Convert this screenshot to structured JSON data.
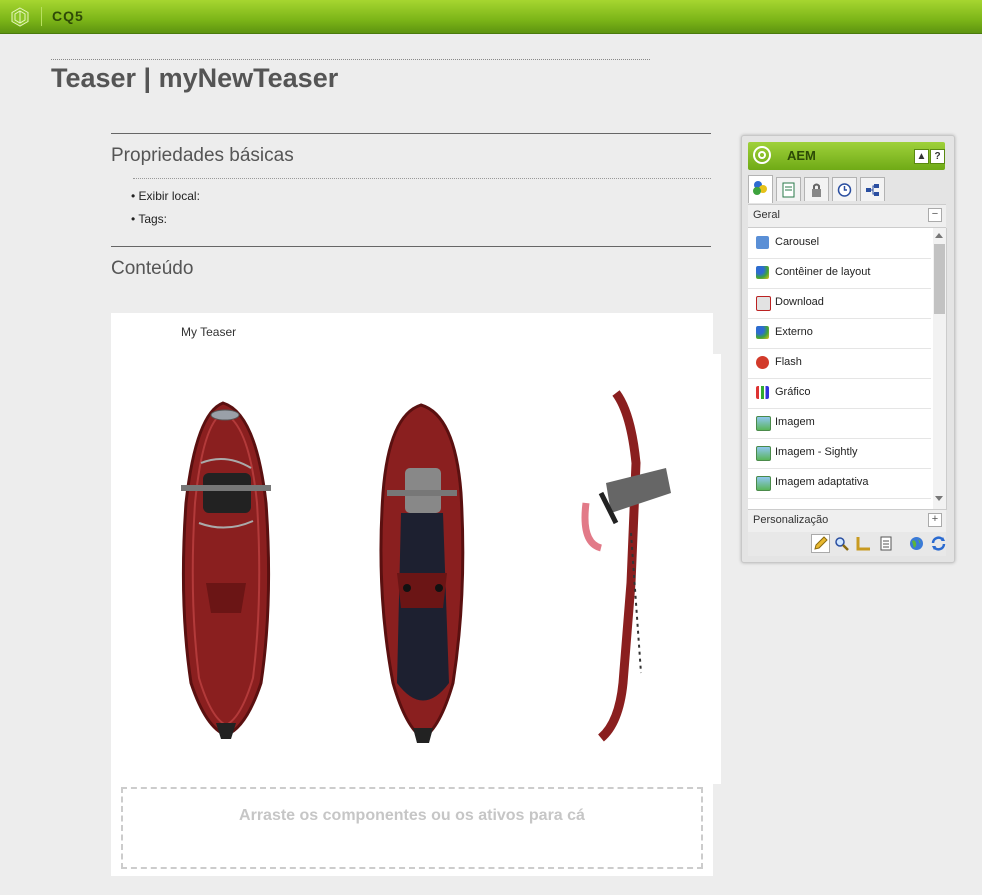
{
  "topbar": {
    "brand": "CQ5"
  },
  "page": {
    "title": "Teaser | myNewTeaser"
  },
  "basic": {
    "heading": "Propriedades básicas",
    "items": [
      {
        "label": "Exibir local:"
      },
      {
        "label": "Tags:"
      }
    ]
  },
  "content": {
    "heading": "Conteúdo"
  },
  "teaser": {
    "title": "My Teaser",
    "image_alt": "snowshoes",
    "dropzone": "Arraste os componentes ou os ativos para cá"
  },
  "sidekick": {
    "title": "AEM",
    "group_geral": "Geral",
    "group_personal": "Personalização",
    "items": [
      {
        "label": "Carousel",
        "icon": "carousel-icon"
      },
      {
        "label": "Contêiner de layout",
        "icon": "layout-container-icon"
      },
      {
        "label": "Download",
        "icon": "download-icon"
      },
      {
        "label": "Externo",
        "icon": "external-icon"
      },
      {
        "label": "Flash",
        "icon": "flash-icon"
      },
      {
        "label": "Gráfico",
        "icon": "chart-icon"
      },
      {
        "label": "Imagem",
        "icon": "image-icon"
      },
      {
        "label": "Imagem - Sightly",
        "icon": "image-icon"
      },
      {
        "label": "Imagem adaptativa",
        "icon": "image-icon"
      }
    ]
  },
  "colors": {
    "brand_green": "#7cb518",
    "accent": "#6faa16"
  }
}
